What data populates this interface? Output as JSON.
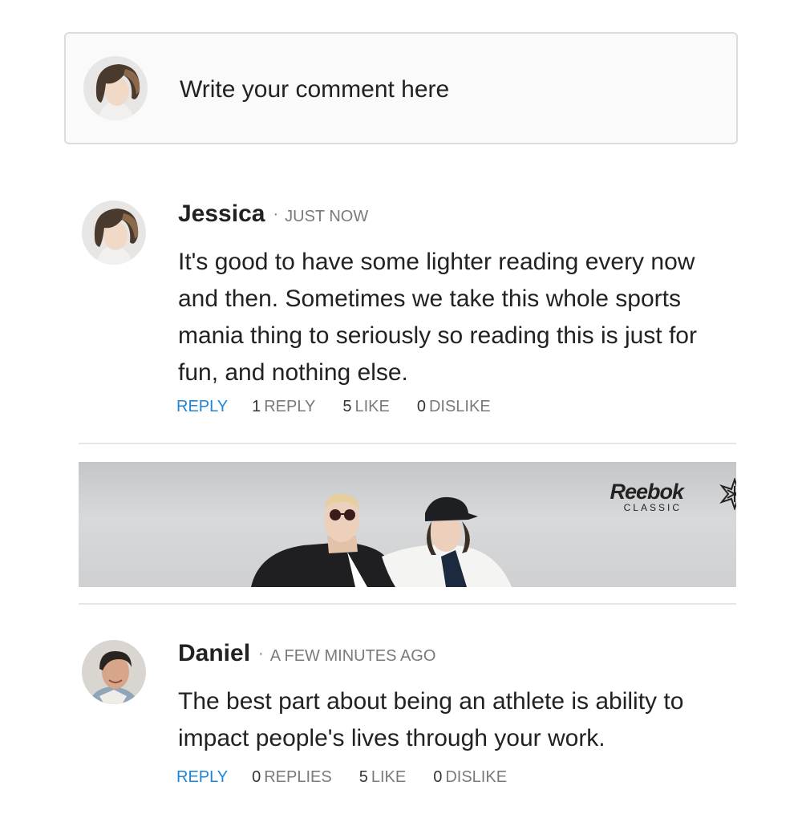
{
  "composer": {
    "placeholder": "Write your comment here"
  },
  "comments": [
    {
      "author": "Jessica",
      "separator": "·",
      "time": "JUST NOW",
      "text": "It's good to have some lighter reading every now and then. Sometimes we take this whole sports mania thing to seriously so reading this is just for fun, and nothing else.",
      "reply_label": "REPLY",
      "replies_count": "1",
      "replies_label": "REPLY",
      "like_count": "5",
      "like_label": "LIKE",
      "dislike_count": "0",
      "dislike_label": "DISLIKE"
    },
    {
      "author": "Daniel",
      "separator": "·",
      "time": "A FEW MINUTES AGO",
      "text": "The best part about being an athlete is ability to impact people's lives through your work.",
      "reply_label": "REPLY",
      "replies_count": "0",
      "replies_label": "REPLIES",
      "like_count": "5",
      "like_label": "LIKE",
      "dislike_count": "0",
      "dislike_label": "DISLIKE"
    }
  ],
  "ad": {
    "brand": "Reebok",
    "brand_sub": "CLASSIC"
  },
  "colors": {
    "accent": "#1e86d8",
    "muted": "#7a7a7a",
    "border": "#dcdcdc",
    "divider": "#e6e6e6"
  },
  "icons": {
    "brand_logo": "reebok-starcrest-icon"
  }
}
